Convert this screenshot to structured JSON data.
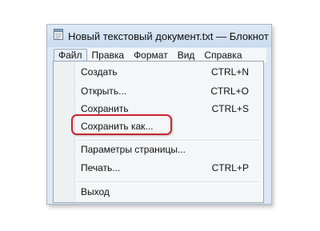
{
  "window": {
    "title": "Новый текстовый документ.txt — Блокнот",
    "icon": "notepad-doc-icon"
  },
  "menubar": {
    "items": [
      "Файл",
      "Правка",
      "Формат",
      "Вид",
      "Справка"
    ],
    "active": "Файл"
  },
  "file_menu": {
    "items": [
      {
        "label": "Создать",
        "shortcut": "CTRL+N"
      },
      {
        "label": "Открыть...",
        "shortcut": "CTRL+O"
      },
      {
        "label": "Сохранить",
        "shortcut": "CTRL+S"
      },
      {
        "label": "Сохранить как...",
        "shortcut": ""
      },
      {
        "label": "Параметры страницы...",
        "shortcut": ""
      },
      {
        "label": "Печать...",
        "shortcut": "CTRL+P"
      },
      {
        "label": "Выход",
        "shortcut": ""
      }
    ],
    "highlighted": "Сохранить как..."
  },
  "colors": {
    "highlight_ring": "#c8262e",
    "window_frame": "#dce8f5"
  }
}
